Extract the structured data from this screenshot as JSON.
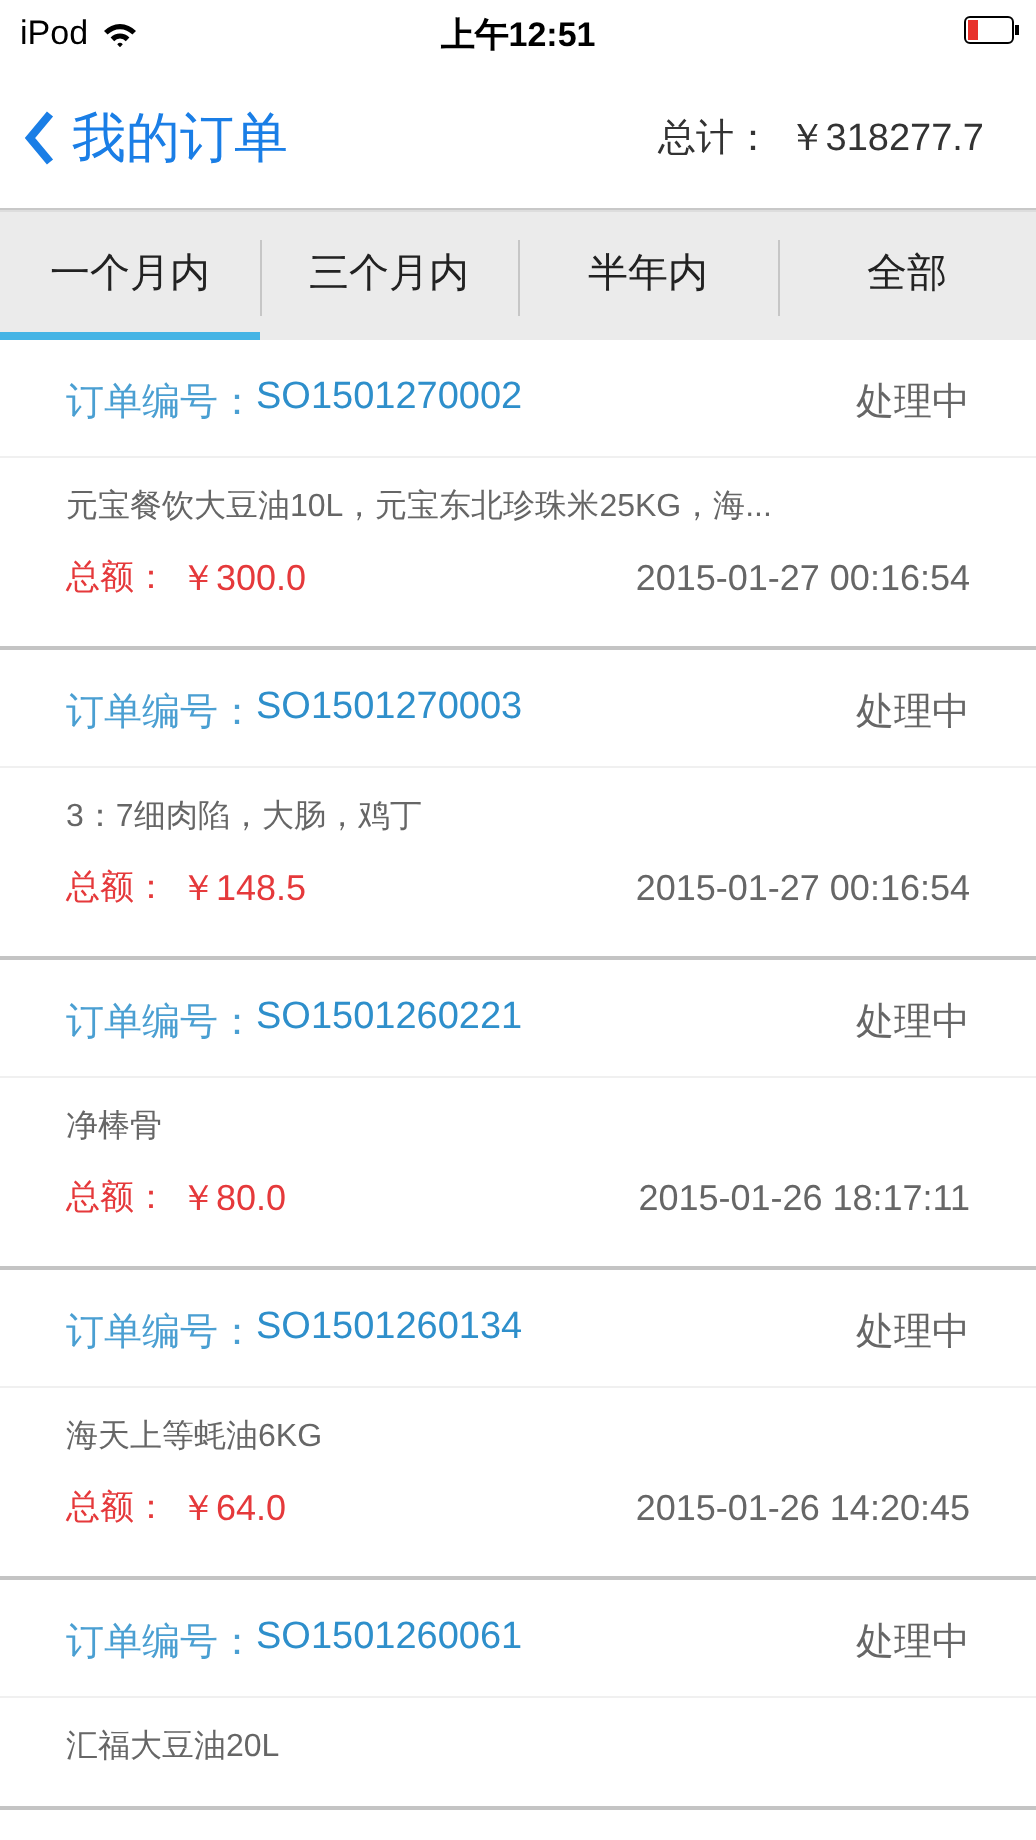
{
  "status_bar": {
    "carrier": "iPod",
    "time": "上午12:51"
  },
  "nav": {
    "back": "我的订单",
    "total_label": "总计：",
    "total": "￥318277.7"
  },
  "tabs": [
    {
      "label": "一个月内",
      "selected": true
    },
    {
      "label": "三个月内",
      "selected": false
    },
    {
      "label": "半年内",
      "selected": false
    },
    {
      "label": "全部",
      "selected": false
    }
  ],
  "orders": [
    {
      "label": "订单编号：",
      "number": "SO1501270002",
      "status": "处理中",
      "items": "元宝餐饮大豆油10L，元宝东北珍珠米25KG，海...",
      "amount_label": "总额：",
      "amount": "￥300.0",
      "time": "2015-01-27 00:16:54"
    },
    {
      "label": "订单编号：",
      "number": "SO1501270003",
      "status": "处理中",
      "items": "3：7细肉陷，大肠，鸡丁",
      "amount_label": "总额：",
      "amount": "￥148.5",
      "time": "2015-01-27 00:16:54"
    },
    {
      "label": "订单编号：",
      "number": "SO1501260221",
      "status": "处理中",
      "items": "净棒骨",
      "amount_label": "总额：",
      "amount": "￥80.0",
      "time": "2015-01-26 18:17:11"
    },
    {
      "label": "订单编号：",
      "number": "SO1501260134",
      "status": "处理中",
      "items": "海天上等蚝油6KG",
      "amount_label": "总额：",
      "amount": "￥64.0",
      "time": "2015-01-26 14:20:45"
    },
    {
      "label": "订单编号：",
      "number": "SO1501260061",
      "status": "处理中",
      "items": "汇福大豆油20L"
    }
  ]
}
